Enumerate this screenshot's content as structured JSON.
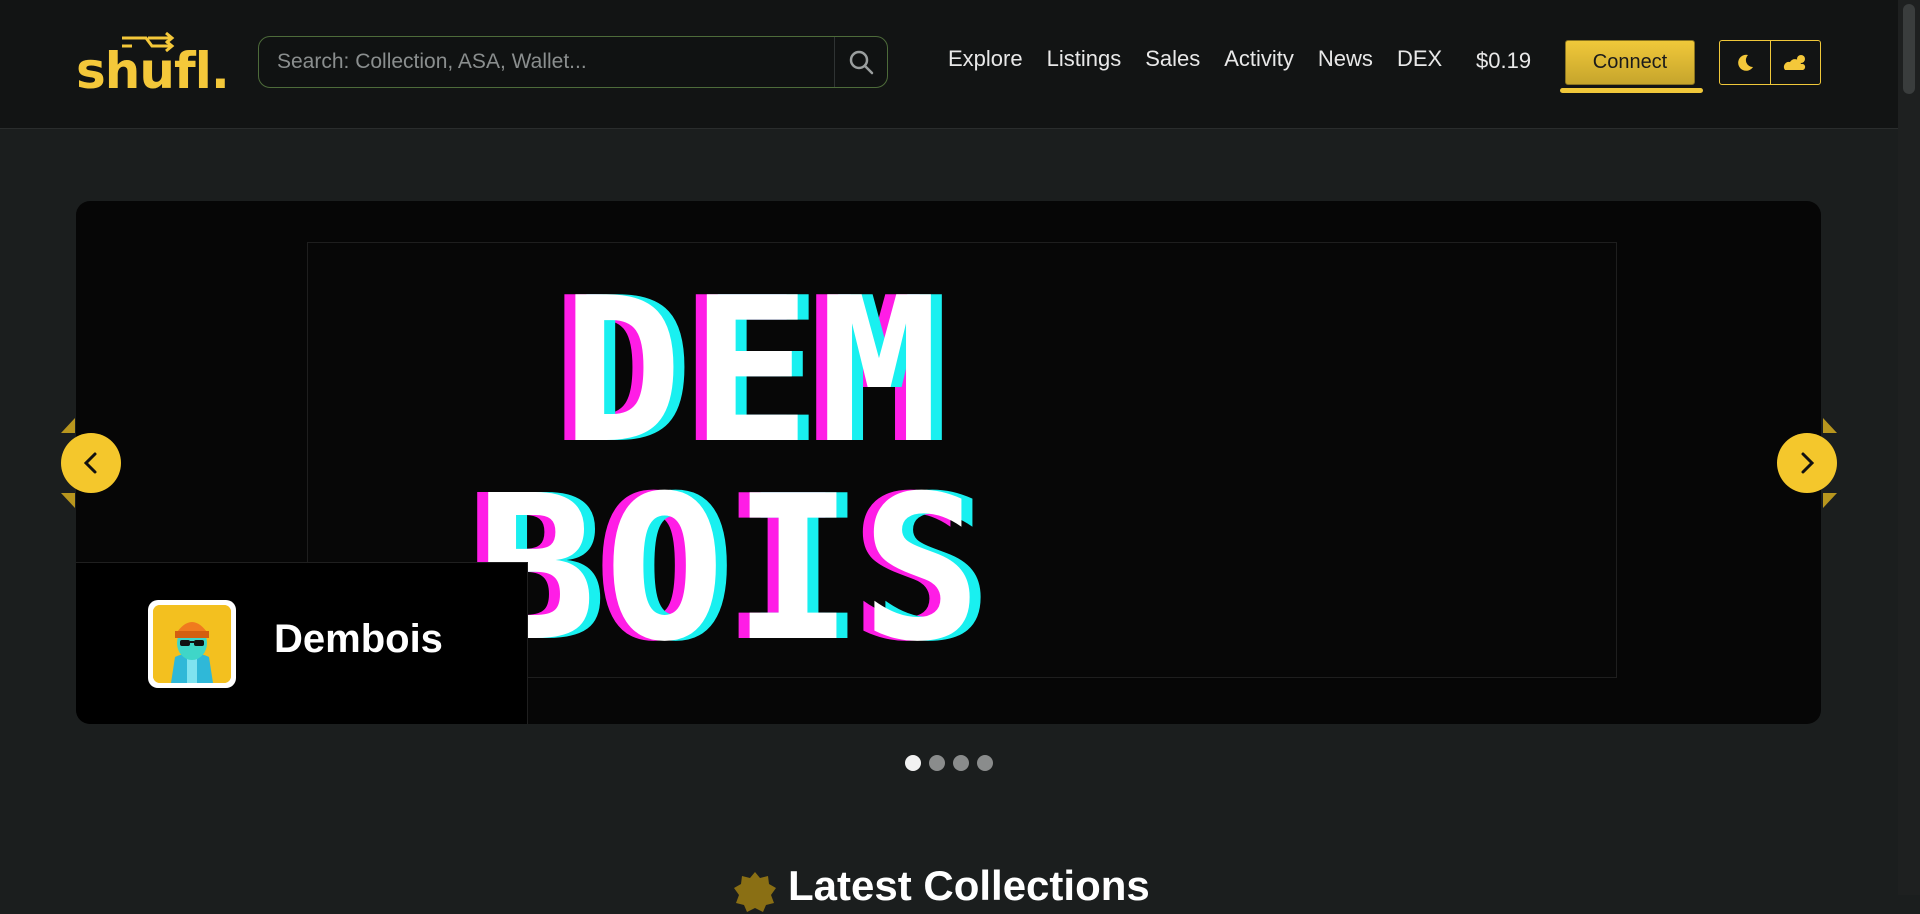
{
  "header": {
    "logo": "shufl.",
    "search": {
      "placeholder": "Search: Collection, ASA, Wallet..."
    },
    "nav": [
      "Explore",
      "Listings",
      "Sales",
      "Activity",
      "News",
      "DEX"
    ],
    "price": "$0.19",
    "connect_label": "Connect",
    "icons": [
      "search-icon",
      "moon-icon",
      "weather-icon"
    ]
  },
  "carousel": {
    "banner_lines": [
      "DEM",
      "BOIS"
    ],
    "collection_name": "Dembois",
    "slides": 4,
    "active_slide": 0
  },
  "section": {
    "title": "Latest Collections"
  },
  "colors": {
    "accent": "#f4c72c",
    "magenta": "#ff1de6",
    "cyan": "#19f0f0",
    "background": "#1b1e1e"
  }
}
